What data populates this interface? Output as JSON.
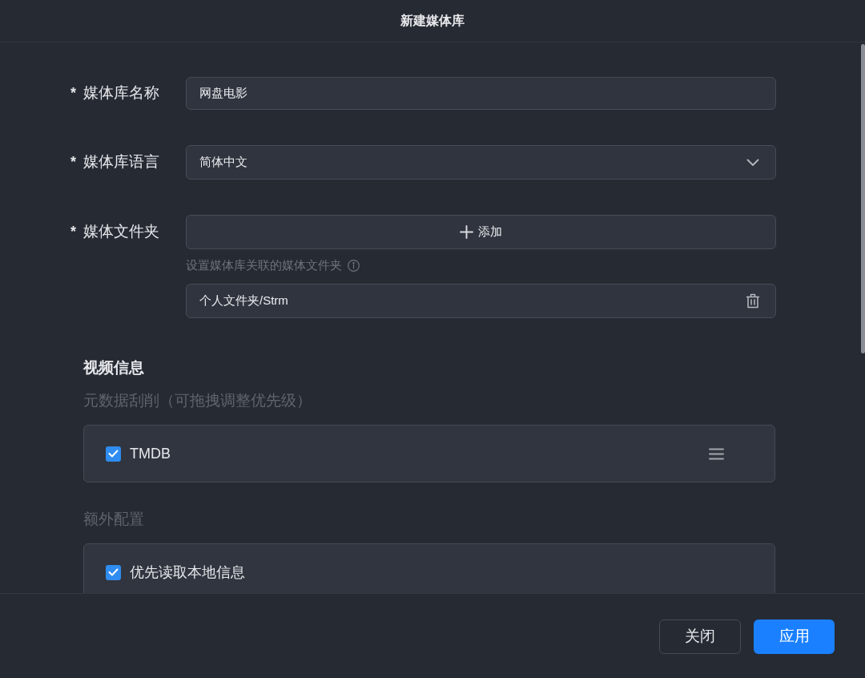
{
  "dialog": {
    "title": "新建媒体库"
  },
  "fields": [
    {
      "kind": "text",
      "required_mark": "*",
      "label": "媒体库名称",
      "value": "网盘电影"
    },
    {
      "kind": "select",
      "required_mark": "*",
      "label": "媒体库语言",
      "value": "简体中文"
    },
    {
      "kind": "folders",
      "required_mark": "*",
      "label": "媒体文件夹",
      "add_button": "添加",
      "hint": "设置媒体库关联的媒体文件夹",
      "folders": [
        "个人文件夹/Strm"
      ]
    }
  ],
  "video_info": {
    "title": "视频信息",
    "sections": [
      {
        "label": "元数据刮削（可拖拽调整优先级）",
        "items": [
          {
            "label": "TMDB",
            "checked": true,
            "draggable": true
          }
        ]
      },
      {
        "label": "额外配置",
        "items": [
          {
            "label": "优先读取本地信息",
            "checked": true,
            "draggable": false
          }
        ]
      }
    ]
  },
  "footer": {
    "buttons": [
      {
        "label": "关闭",
        "kind": "secondary"
      },
      {
        "label": "应用",
        "kind": "primary"
      }
    ]
  }
}
